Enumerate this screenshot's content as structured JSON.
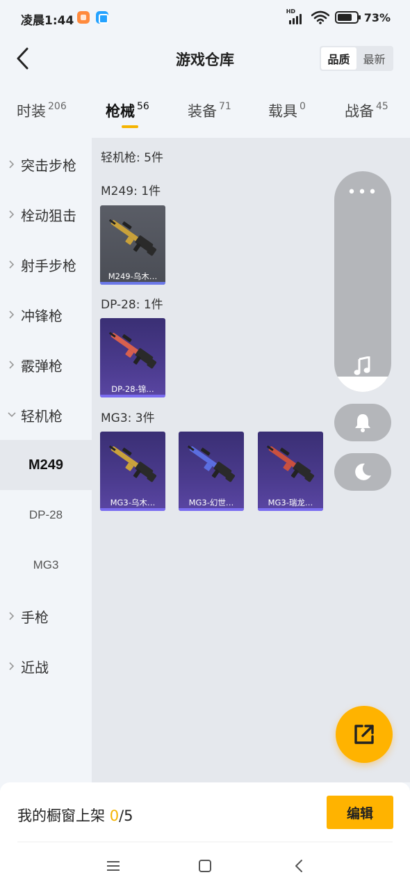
{
  "status_bar": {
    "time": "凌晨1:44",
    "network_badge": "HD",
    "battery": "73%"
  },
  "header": {
    "title": "游戏仓库",
    "sort_options": [
      "品质",
      "最新"
    ],
    "active_sort": "品质"
  },
  "tabs": [
    {
      "label": "时装",
      "count": "206"
    },
    {
      "label": "枪械",
      "count": "56",
      "active": true
    },
    {
      "label": "装备",
      "count": "71"
    },
    {
      "label": "载具",
      "count": "0"
    },
    {
      "label": "战备",
      "count": "45"
    }
  ],
  "sidebar": {
    "items": [
      {
        "label": "突击步枪"
      },
      {
        "label": "栓动狙击"
      },
      {
        "label": "射手步枪"
      },
      {
        "label": "冲锋枪"
      },
      {
        "label": "霰弹枪"
      },
      {
        "label": "轻机枪",
        "expanded": true
      },
      {
        "label": "手枪"
      },
      {
        "label": "近战"
      }
    ],
    "sub_items": [
      {
        "label": "M249",
        "active": true
      },
      {
        "label": "DP-28"
      },
      {
        "label": "MG3"
      }
    ]
  },
  "content": {
    "summary": "轻机枪: 5件",
    "groups": [
      {
        "title": "M249: 1件",
        "cards": [
          {
            "caption": "M249-乌木…",
            "style": "gray",
            "gun_color": "#c9a13a"
          }
        ]
      },
      {
        "title": "DP-28: 1件",
        "cards": [
          {
            "caption": "DP-28-锦…",
            "style": "purple",
            "gun_color": "#d8604e"
          }
        ]
      },
      {
        "title": "MG3: 3件",
        "cards": [
          {
            "caption": "MG3-乌木…",
            "style": "purple",
            "gun_color": "#caa23c"
          },
          {
            "caption": "MG3-幻世…",
            "style": "purple",
            "gun_color": "#5b6ee0"
          },
          {
            "caption": "MG3-瑞龙…",
            "style": "purple",
            "gun_color": "#c9503f"
          }
        ]
      }
    ]
  },
  "float_panel": {
    "more_icon": "more-dots-icon",
    "music_icon": "music-note-icon",
    "bell_icon": "bell-icon",
    "moon_icon": "moon-icon"
  },
  "share_fab": {
    "icon": "share-external-icon",
    "color": "#ffb300"
  },
  "showcase": {
    "label": "我的橱窗上架",
    "current": "0",
    "total": "/5",
    "edit_label": "编辑"
  },
  "colors": {
    "accent": "#ffb300",
    "tab_underline": "#f5b400",
    "rare_purple": "#4b3b8e"
  }
}
